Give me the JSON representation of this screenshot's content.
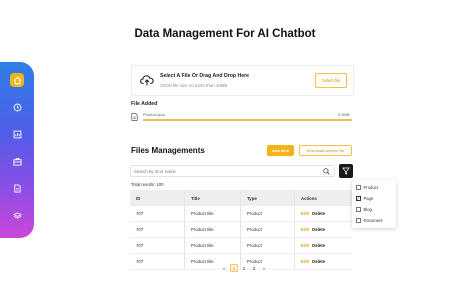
{
  "header": {
    "title": "Data Management For AI Chatbot"
  },
  "sidebar": {
    "accent": "#f5b41a",
    "items": [
      {
        "icon": "home-icon",
        "active": true
      },
      {
        "icon": "history-icon",
        "active": false
      },
      {
        "icon": "analytics-icon",
        "active": false
      },
      {
        "icon": "briefcase-icon",
        "active": false
      },
      {
        "icon": "document-icon",
        "active": false
      },
      {
        "icon": "database-icon",
        "active": false
      }
    ]
  },
  "upload": {
    "title": "Select A File Or Drag And Drop Here",
    "subtitle": "JSON file size no more than 10MB",
    "button_label": "Select file"
  },
  "file_added": {
    "label": "File Added",
    "file_name": "Product.json",
    "file_size": "5.9MB",
    "progress": 1.0
  },
  "files": {
    "title": "Files Managements",
    "add_button": "Add item",
    "download_button": "Download sample file",
    "search_placeholder": "Search by ID or name",
    "total_results": "Total results: 100",
    "columns": [
      "ID",
      "Title",
      "Type",
      "Actions"
    ],
    "rows": [
      {
        "id": "707",
        "title": "Product title",
        "type": "Product",
        "edit": "Edit",
        "delete": "Delete"
      },
      {
        "id": "707",
        "title": "Product title",
        "type": "Product",
        "edit": "Edit",
        "delete": "Delete"
      },
      {
        "id": "707",
        "title": "Product title",
        "type": "Product",
        "edit": "Edit",
        "delete": "Delete"
      },
      {
        "id": "707",
        "title": "Product title",
        "type": "Product",
        "edit": "Edit",
        "delete": "Delete"
      }
    ]
  },
  "pagination": {
    "prev": "«",
    "pages": [
      "1",
      "2",
      "3"
    ],
    "next": "»",
    "current": "1"
  },
  "filter": {
    "options": [
      {
        "label": "Product",
        "checked": false
      },
      {
        "label": "Page",
        "checked": true
      },
      {
        "label": "Blog",
        "checked": false
      },
      {
        "label": "Document",
        "checked": false
      }
    ]
  }
}
